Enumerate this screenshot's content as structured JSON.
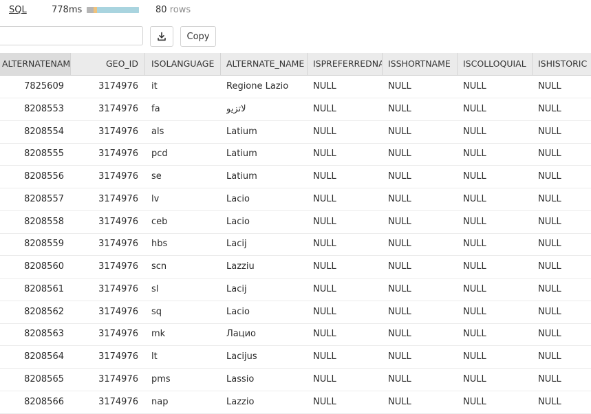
{
  "topbar": {
    "sql_label": "SQL",
    "time": "778ms",
    "rows_count": "80",
    "rows_unit": "rows",
    "timing_segments": [
      {
        "name": "gray",
        "color": "#b5b5b5",
        "fraction": 0.13
      },
      {
        "name": "orange",
        "color": "#f0c27b",
        "fraction": 0.07
      },
      {
        "name": "blue",
        "color": "#a9d4df",
        "fraction": 0.8
      }
    ]
  },
  "toolbar": {
    "filter_value": "",
    "filter_placeholder": "",
    "copy_label": "Copy",
    "download_icon": "download-icon"
  },
  "table": {
    "columns": [
      "ALTERNATENAME_ID",
      "GEO_ID",
      "ISOLANGUAGE",
      "ALTERNATE_NAME",
      "ISPREFERREDNAME",
      "ISSHORTNAME",
      "ISCOLLOQUIAL",
      "ISHISTORIC"
    ],
    "rows": [
      [
        "7825609",
        "3174976",
        "it",
        "Regione Lazio",
        "NULL",
        "NULL",
        "NULL",
        "NULL"
      ],
      [
        "8208553",
        "3174976",
        "fa",
        "لاتزیو",
        "NULL",
        "NULL",
        "NULL",
        "NULL"
      ],
      [
        "8208554",
        "3174976",
        "als",
        "Latium",
        "NULL",
        "NULL",
        "NULL",
        "NULL"
      ],
      [
        "8208555",
        "3174976",
        "pcd",
        "Latium",
        "NULL",
        "NULL",
        "NULL",
        "NULL"
      ],
      [
        "8208556",
        "3174976",
        "se",
        "Latium",
        "NULL",
        "NULL",
        "NULL",
        "NULL"
      ],
      [
        "8208557",
        "3174976",
        "lv",
        "Lacio",
        "NULL",
        "NULL",
        "NULL",
        "NULL"
      ],
      [
        "8208558",
        "3174976",
        "ceb",
        "Lacio",
        "NULL",
        "NULL",
        "NULL",
        "NULL"
      ],
      [
        "8208559",
        "3174976",
        "hbs",
        "Lacij",
        "NULL",
        "NULL",
        "NULL",
        "NULL"
      ],
      [
        "8208560",
        "3174976",
        "scn",
        "Lazziu",
        "NULL",
        "NULL",
        "NULL",
        "NULL"
      ],
      [
        "8208561",
        "3174976",
        "sl",
        "Lacij",
        "NULL",
        "NULL",
        "NULL",
        "NULL"
      ],
      [
        "8208562",
        "3174976",
        "sq",
        "Lacio",
        "NULL",
        "NULL",
        "NULL",
        "NULL"
      ],
      [
        "8208563",
        "3174976",
        "mk",
        "Лацио",
        "NULL",
        "NULL",
        "NULL",
        "NULL"
      ],
      [
        "8208564",
        "3174976",
        "lt",
        "Lacijus",
        "NULL",
        "NULL",
        "NULL",
        "NULL"
      ],
      [
        "8208565",
        "3174976",
        "pms",
        "Lassio",
        "NULL",
        "NULL",
        "NULL",
        "NULL"
      ],
      [
        "8208566",
        "3174976",
        "nap",
        "Lazzio",
        "NULL",
        "NULL",
        "NULL",
        "NULL"
      ]
    ]
  }
}
